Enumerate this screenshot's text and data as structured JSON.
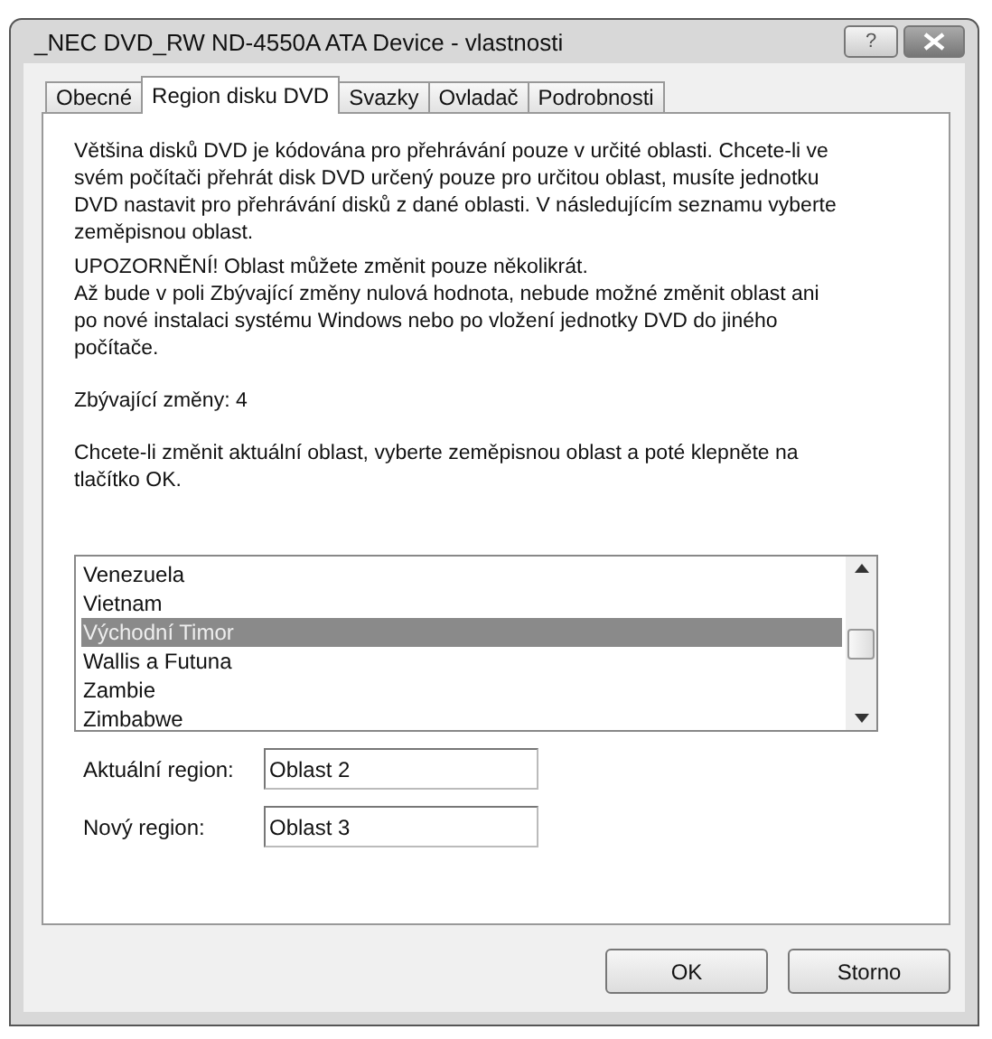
{
  "window": {
    "title": "_NEC DVD_RW ND-4550A ATA Device - vlastnosti",
    "help_button": "?"
  },
  "tabs": [
    {
      "label": "Obecné",
      "selected": false
    },
    {
      "label": "Region disku DVD",
      "selected": true
    },
    {
      "label": "Svazky",
      "selected": false
    },
    {
      "label": "Ovladač",
      "selected": false
    },
    {
      "label": "Podrobnosti",
      "selected": false
    }
  ],
  "text_blocks": [
    [
      "Většina disků DVD je kódována pro přehrávání pouze v určité oblasti. Chcete-li ve svém počítači přehrát disk DVD určený pouze pro určitou oblast, musíte jednotku DVD nastavit pro přehrávání disků z dané oblasti. V následujícím seznamu vyberte zeměpisnou oblast."
    ],
    [
      "UPOZORNĚNÍ!  Oblast můžete změnit pouze několikrát.",
      "Až bude v poli Zbývající změny nulová hodnota, nebude možné změnit oblast ani po nové instalaci systému Windows nebo po vložení jednotky DVD do jiného počítače."
    ],
    [
      "Zbývající změny: 4"
    ],
    [
      "Chcete-li změnit aktuální oblast, vyberte zeměpisnou oblast a poté klepněte na tlačítko OK."
    ]
  ],
  "regions": [
    {
      "label": "Venezuela",
      "selected": false
    },
    {
      "label": "Vietnam",
      "selected": false
    },
    {
      "label": "Východní Timor",
      "selected": true
    },
    {
      "label": "Wallis a Futuna",
      "selected": false
    },
    {
      "label": "Zambie",
      "selected": false
    },
    {
      "label": "Zimbabwe",
      "selected": false
    }
  ],
  "fields": [
    {
      "label": "Aktuální region:",
      "value": "Oblast 2"
    },
    {
      "label": "Nový region:",
      "value": "Oblast 3"
    }
  ],
  "buttons": [
    "OK",
    "Storno"
  ]
}
